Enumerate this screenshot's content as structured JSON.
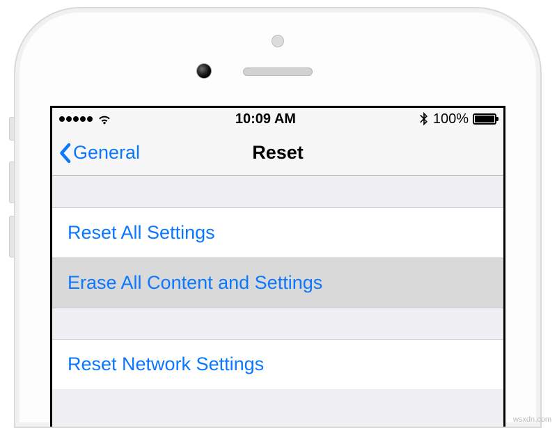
{
  "statusBar": {
    "time": "10:09 AM",
    "batteryText": "100%"
  },
  "nav": {
    "backLabel": "General",
    "title": "Reset"
  },
  "cells": {
    "resetAll": "Reset All Settings",
    "eraseAll": "Erase All Content and Settings",
    "resetNetwork": "Reset Network Settings"
  },
  "watermark": "wsxdn.com"
}
